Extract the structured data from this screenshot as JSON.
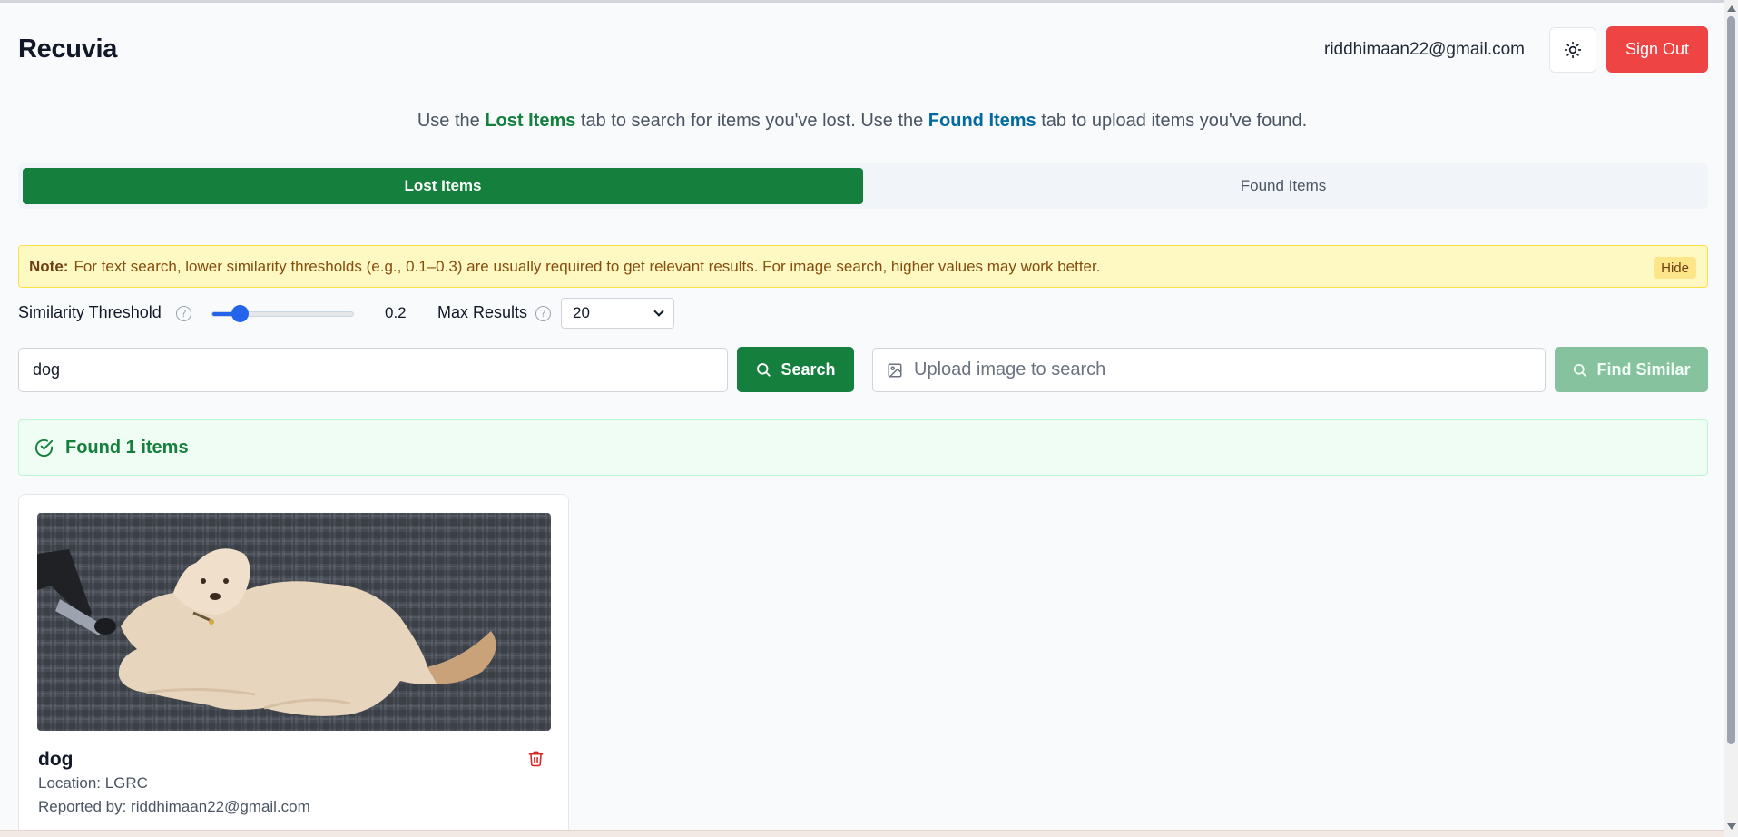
{
  "app": {
    "title": "Recuvia"
  },
  "header": {
    "user_email": "riddhimaan22@gmail.com",
    "theme_icon": "sun-icon",
    "signout_label": "Sign Out"
  },
  "intro": {
    "part1": "Use the ",
    "lost_link": "Lost Items",
    "part2": " tab to search for items you've lost. Use the ",
    "found_link": "Found Items",
    "part3": " tab to upload items you've found."
  },
  "tabs": [
    {
      "label": "Lost Items",
      "active": true
    },
    {
      "label": "Found Items",
      "active": false
    }
  ],
  "note": {
    "title": "Note:",
    "text": "For text search, lower similarity thresholds (e.g., 0.1–0.3) are usually required to get relevant results. For image search, higher values may work better.",
    "hide_label": "Hide"
  },
  "controls": {
    "threshold_label": "Similarity Threshold",
    "threshold_value": "0.2",
    "threshold_fraction": 0.2,
    "max_results_label": "Max Results",
    "max_results_value": "20"
  },
  "search": {
    "query": "dog",
    "button_label": "Search",
    "upload_placeholder": "Upload image to search",
    "find_similar_label": "Find Similar"
  },
  "results": {
    "summary": "Found 1 items",
    "items": [
      {
        "title": "dog",
        "location": "Location: LGRC",
        "reported_by": "Reported by: riddhimaan22@gmail.com"
      }
    ]
  },
  "colors": {
    "brand_green": "#15803d",
    "danger_red": "#ef4444",
    "link_blue": "#0369a1",
    "note_yellow": "#fef9c3"
  }
}
